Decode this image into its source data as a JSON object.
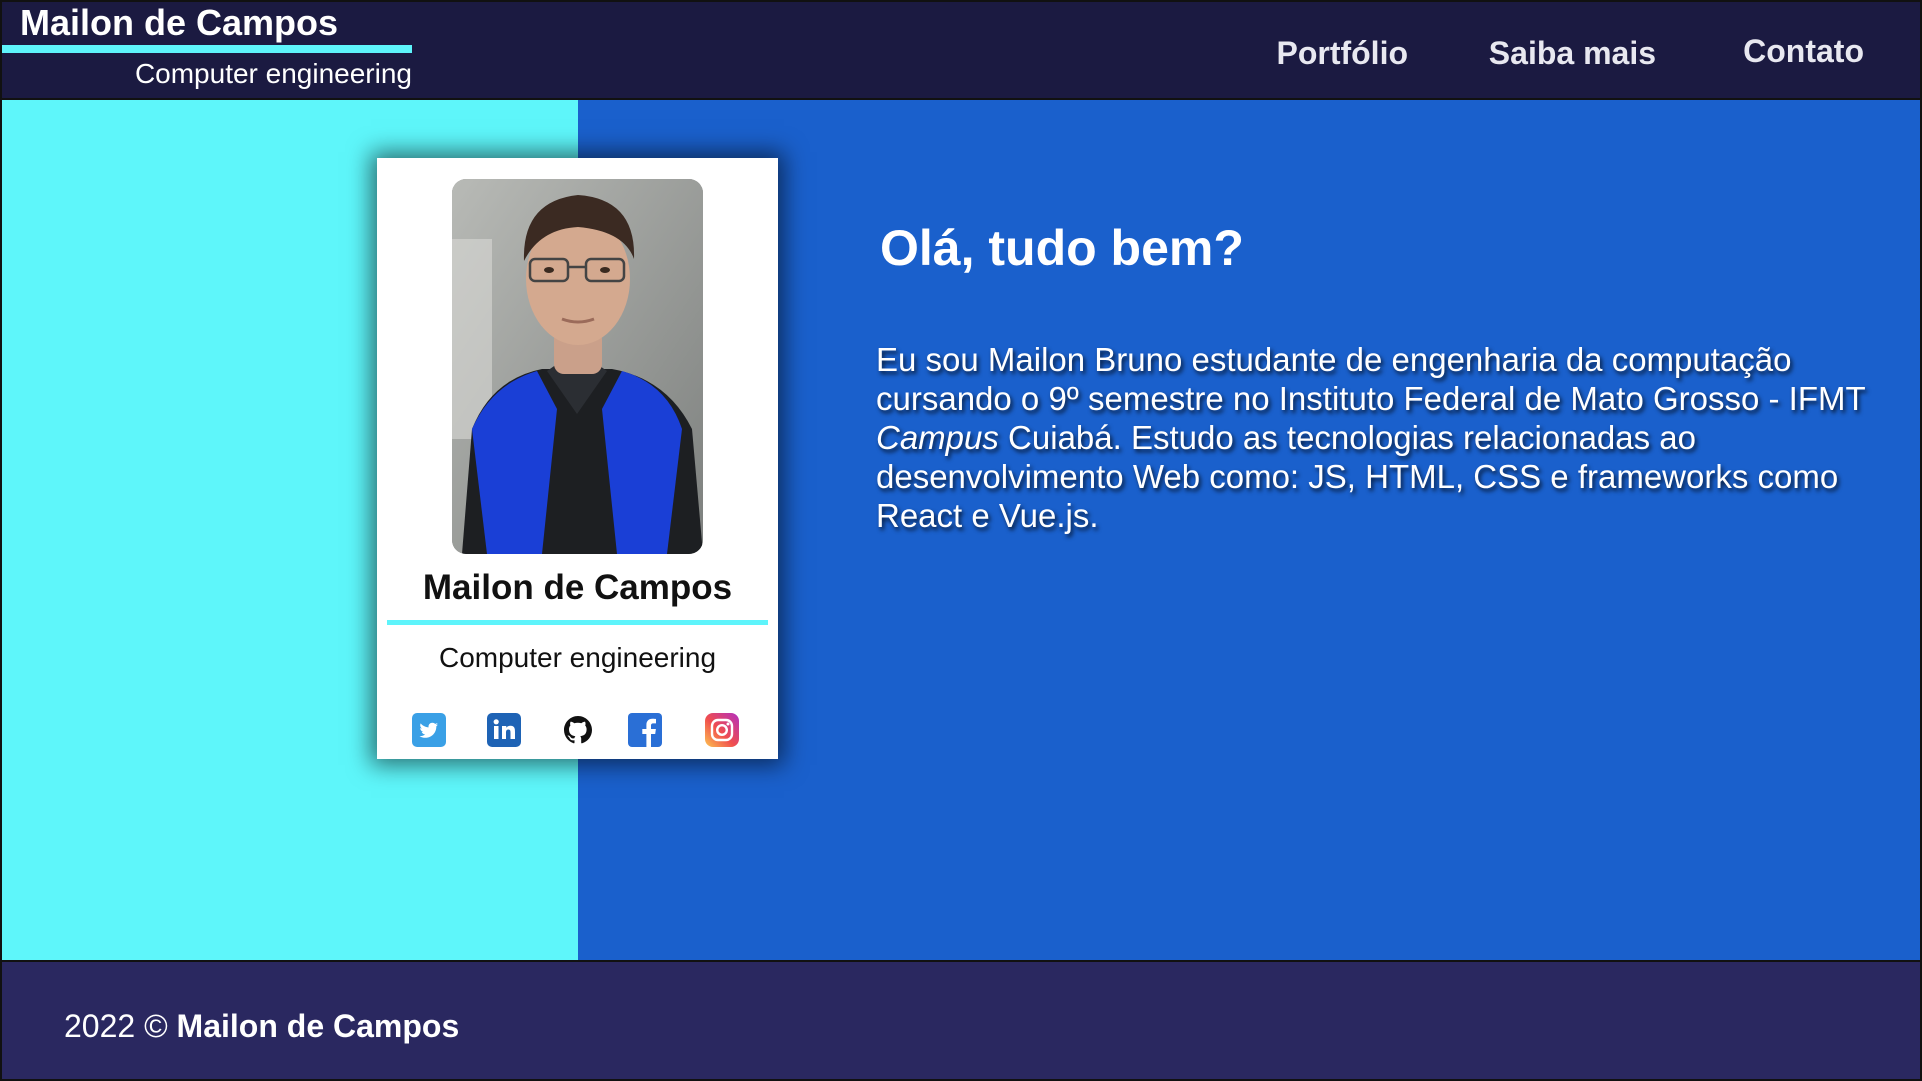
{
  "header": {
    "brand_name": "Mailon de Campos",
    "brand_subtitle": "Computer engineering",
    "nav": [
      {
        "label": "Portfólio"
      },
      {
        "label": "Saiba mais"
      },
      {
        "label": "Contato"
      }
    ]
  },
  "card": {
    "name": "Mailon de Campos",
    "subtitle": "Computer engineering",
    "socials": [
      {
        "icon": "twitter-icon",
        "color": "#1da1f2"
      },
      {
        "icon": "linkedin-icon",
        "color": "#0a66c2"
      },
      {
        "icon": "github-icon",
        "color": "#111111"
      },
      {
        "icon": "facebook-icon",
        "color": "#1877f2"
      },
      {
        "icon": "instagram-icon",
        "color": "#e1306c"
      }
    ]
  },
  "main": {
    "greeting": "Olá, tudo bem?",
    "about_part1": "Eu sou Mailon Bruno estudante de engenharia da computação cursando o 9º semestre no Instituto Federal de Mato Grosso - IFMT ",
    "about_italic": "Campus",
    "about_part2": " Cuiabá. Estudo as tecnologias relacionadas ao desenvolvimento Web como: JS, HTML, CSS e frameworks como React e Vue.js."
  },
  "footer": {
    "year_copy": "2022 © ",
    "owner": "Mailon de Campos"
  },
  "colors": {
    "header_bg": "#1b1a41",
    "accent_cyan": "#5ef4fb",
    "main_blue": "#1a60cc",
    "footer_bg": "#2a2860"
  }
}
